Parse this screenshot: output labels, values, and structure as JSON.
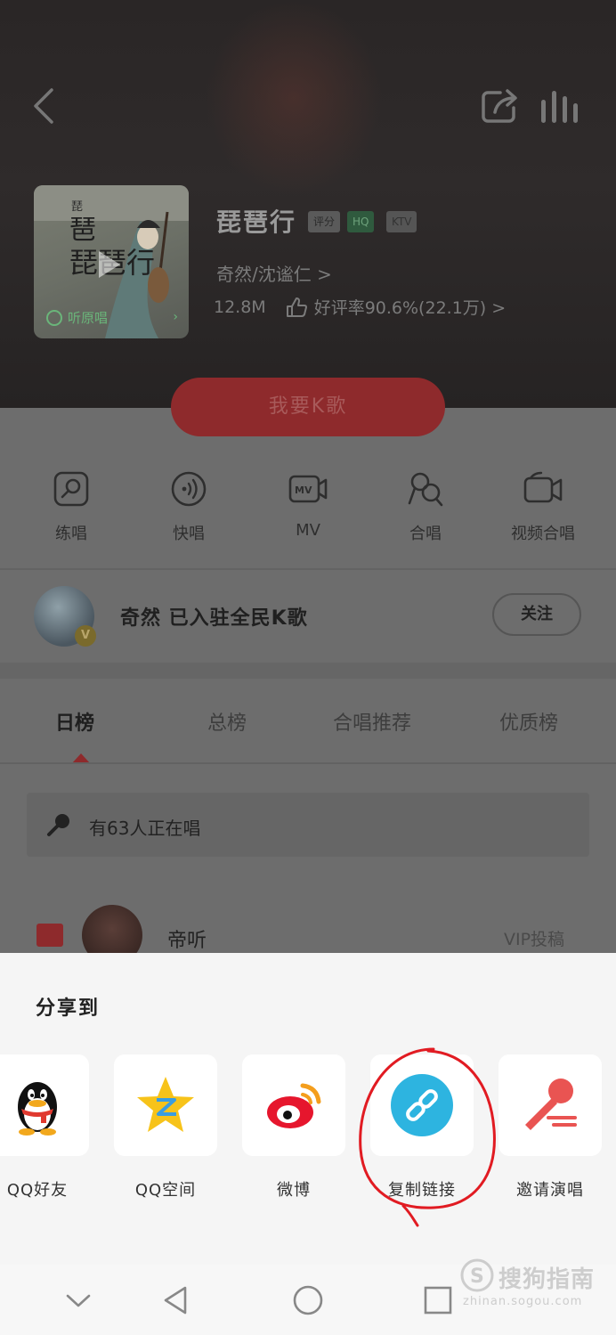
{
  "song": {
    "title": "琵琶行",
    "tags": [
      "评分",
      "HQ",
      "KTV"
    ],
    "artist": "奇然/沈谧仁 >",
    "size": "12.8M",
    "rating": "好评率90.6%(22.1万) >",
    "cover_listen": "听原唱",
    "cover_title_art": "琵琶行"
  },
  "k_button": "我要K歌",
  "actions": [
    "练唱",
    "快唱",
    "MV",
    "合唱",
    "视频合唱"
  ],
  "artist_row": {
    "name_text": "奇然  已入驻全民K歌",
    "follow": "关注",
    "badge": "V"
  },
  "tabs": [
    "日榜",
    "总榜",
    "合唱推荐",
    "优质榜"
  ],
  "singing_now": "有63人正在唱",
  "rank_row": {
    "name": "帝听",
    "tag": "VIP投稿"
  },
  "share_sheet": {
    "title": "分享到",
    "items": [
      "QQ好友",
      "QQ空间",
      "微博",
      "复制链接",
      "邀请演唱"
    ]
  },
  "watermark": {
    "main": "搜狗指南",
    "sub": "zhinan.sogou.com"
  },
  "colors": {
    "accent_red": "#e0393e",
    "link_blue": "#2db4e0",
    "qzone_yellow": "#f7c31a"
  }
}
